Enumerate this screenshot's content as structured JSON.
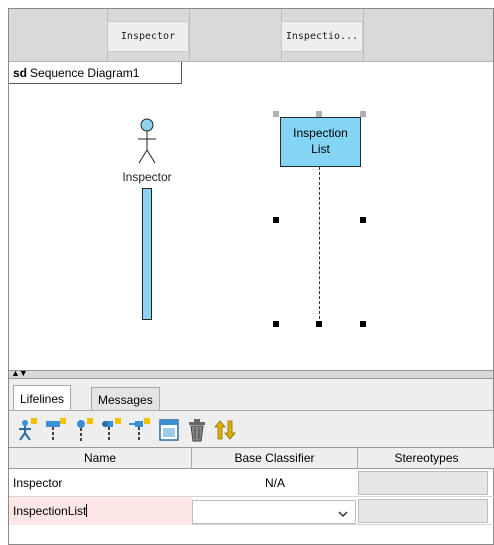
{
  "header": {
    "lifeline_tabs": [
      "Inspector",
      "Inspectio..."
    ]
  },
  "diagram": {
    "frame_keyword": "sd",
    "frame_name": "Sequence Diagram1",
    "actor_name": "Inspector",
    "lifeline_box_line1": "Inspection",
    "lifeline_box_line2": "List"
  },
  "splitter": {
    "arrows": "▲▼"
  },
  "panel": {
    "tabs": [
      "Lifelines",
      "Messages"
    ],
    "toolbar_icons": [
      "add-actor-lifeline-icon",
      "add-lifeline-icon",
      "add-lifeline-alt-icon",
      "add-lifeline-variant-icon",
      "add-gate-lifeline-icon",
      "classifier-table-icon",
      "delete-trash-icon",
      "swap-order-icon"
    ]
  },
  "table": {
    "headers": [
      "Name",
      "Base Classifier",
      "Stereotypes"
    ],
    "rows": [
      {
        "name": "Inspector",
        "base_classifier": "N/A",
        "stereotypes": ""
      },
      {
        "name": "InspectionList",
        "base_classifier": "",
        "stereotypes": ""
      }
    ]
  },
  "colors": {
    "lifeline_fill": "#84d4f5",
    "activation_fill": "#8fd3f3",
    "edit_row_bg": "#fde6e6"
  }
}
